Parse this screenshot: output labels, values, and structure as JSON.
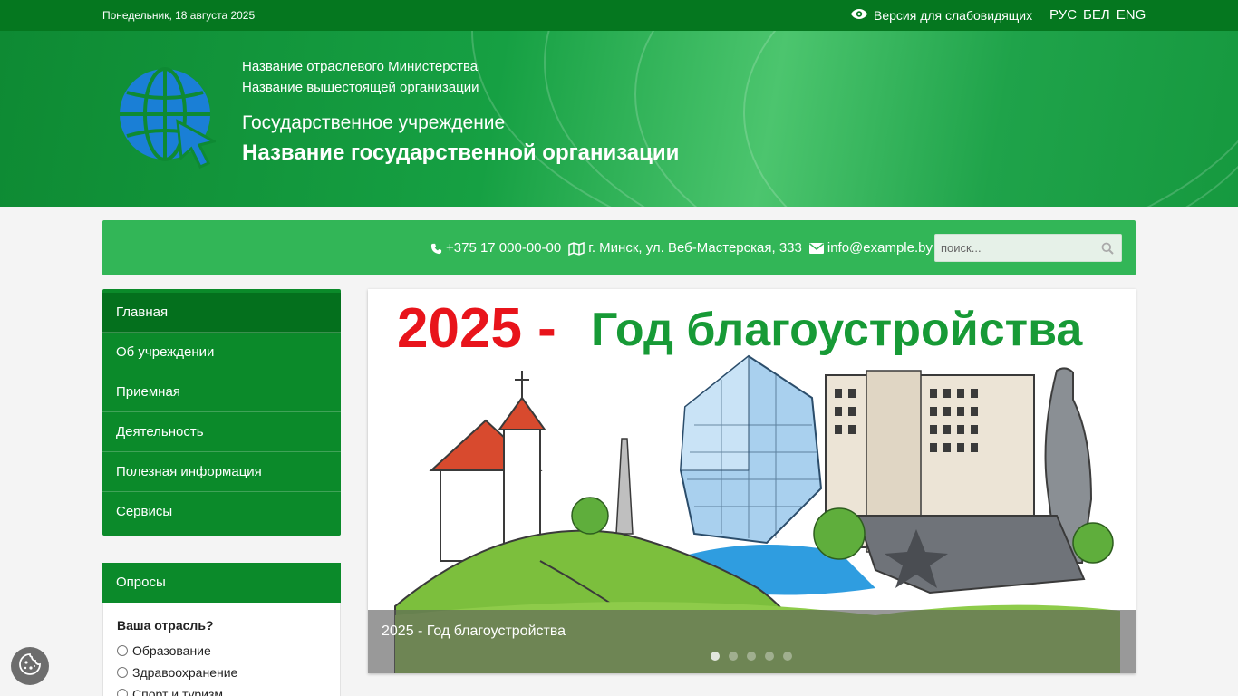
{
  "topbar": {
    "date": "Понедельник, 18 августа 2025",
    "vision_label": "Версия для слабовидящих",
    "langs": [
      "РУС",
      "БЕЛ",
      "ENG"
    ]
  },
  "header": {
    "ministry": "Название отраслевого Министерства",
    "parent_org": "Название вышестоящей организации",
    "org_type": "Государственное учреждение",
    "org_name": "Название государственной организации"
  },
  "contacts": {
    "phone": "+375 17 000-00-00",
    "address": "г. Минск, ул. Веб-Мастерская, 333",
    "email": "info@example.by",
    "search_placeholder": "поиск..."
  },
  "nav": {
    "items": [
      "Главная",
      "Об учреждении",
      "Приемная",
      "Деятельность",
      "Полезная информация",
      "Сервисы"
    ]
  },
  "poll": {
    "title": "Опросы",
    "question": "Ваша отрасль?",
    "options": [
      "Образование",
      "Здравоохранение",
      "Спорт и туризм"
    ]
  },
  "slider": {
    "banner_year": "2025 -",
    "banner_text": "Год благоустройства",
    "caption": "2025 - Год благоустройства",
    "slide_count": 5,
    "active_slide": 1
  },
  "colors": {
    "topbar": "#05771f",
    "contactbar": "#32b657",
    "nav": "#0b8a2a",
    "nav_active": "#04701d",
    "banner_red": "#e8141b",
    "banner_green": "#179a36"
  }
}
